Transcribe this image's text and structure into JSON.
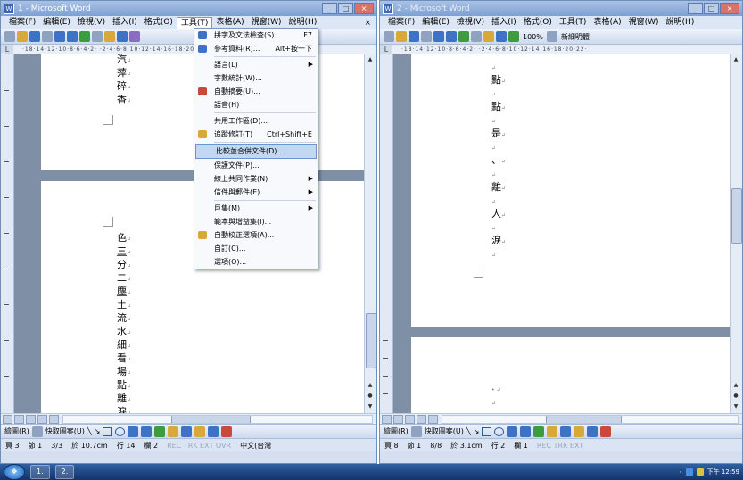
{
  "window1": {
    "title": "1 - Microsoft Word",
    "menu": [
      "檔案(F)",
      "編輯(E)",
      "檢視(V)",
      "插入(I)",
      "格式(O)",
      "工具(T)",
      "表格(A)",
      "視窗(W)",
      "說明(H)"
    ],
    "active_menu_index": 5,
    "close_doc": "×",
    "ruler_text": "·18·14·12·10·8·6·4·2· ·2·4·6·8·10·12·14·16·18·20·22·",
    "page_top_text": [
      "汽",
      "萍",
      "碎",
      "香"
    ],
    "page_bottom_text": [
      "色",
      "三",
      "分",
      "二",
      "塵",
      "土",
      "流",
      "水",
      "細",
      "看",
      "場",
      "點",
      "離",
      "淚"
    ],
    "underlined_chars": [
      "三",
      "塵"
    ],
    "status": {
      "page": "頁 3",
      "section": "節 1",
      "count": "3/3",
      "position": "於 10.7cm",
      "line": "行 14",
      "column": "欄 2",
      "modes": "REC TRK EXT OVR",
      "language": "中文(台灣"
    },
    "draw_label": "繪圖(R)",
    "autoshape_label": "快取圖案(U)"
  },
  "tools_menu": {
    "items": [
      {
        "label": "拼字及文法檢查(S)...",
        "shortcut": "F7",
        "icon": "spellcheck-icon",
        "color": "#3d72c4",
        "arrow": false
      },
      {
        "label": "參考資料(R)...",
        "shortcut": "Alt+按一下",
        "icon": "research-icon",
        "color": "#3d72c4",
        "arrow": false
      },
      {
        "label": "語言(L)",
        "shortcut": "",
        "icon": "",
        "color": "",
        "arrow": true
      },
      {
        "label": "字數統計(W)...",
        "shortcut": "",
        "icon": "",
        "color": "",
        "arrow": false
      },
      {
        "label": "自動摘要(U)...",
        "shortcut": "",
        "icon": "autosummary-icon",
        "color": "#c94a3a",
        "arrow": false
      },
      {
        "label": "語音(H)",
        "shortcut": "",
        "icon": "",
        "color": "",
        "arrow": false
      },
      {
        "label": "共用工作區(D)...",
        "shortcut": "",
        "icon": "",
        "color": "",
        "arrow": false
      },
      {
        "label": "追蹤修訂(T)",
        "shortcut": "Ctrl+Shift+E",
        "icon": "track-changes-icon",
        "color": "#d9a83a",
        "arrow": false
      },
      {
        "label": "比較並合併文件(D)...",
        "shortcut": "",
        "icon": "",
        "color": "",
        "arrow": false,
        "highlight": true
      },
      {
        "label": "保護文件(P)...",
        "shortcut": "",
        "icon": "",
        "color": "",
        "arrow": false
      },
      {
        "label": "線上共同作業(N)",
        "shortcut": "",
        "icon": "",
        "color": "",
        "arrow": true
      },
      {
        "label": "信件與郵件(E)",
        "shortcut": "",
        "icon": "",
        "color": "",
        "arrow": true
      },
      {
        "label": "巨集(M)",
        "shortcut": "",
        "icon": "",
        "color": "",
        "arrow": true
      },
      {
        "label": "範本與增益集(I)...",
        "shortcut": "",
        "icon": "",
        "color": "",
        "arrow": false
      },
      {
        "label": "自動校正選項(A)...",
        "shortcut": "",
        "icon": "autocorrect-icon",
        "color": "#d9a83a",
        "arrow": false
      },
      {
        "label": "自訂(C)...",
        "shortcut": "",
        "icon": "",
        "color": "",
        "arrow": false
      },
      {
        "label": "選項(O)...",
        "shortcut": "",
        "icon": "",
        "color": "",
        "arrow": false
      }
    ]
  },
  "window2": {
    "title": "2 - Microsoft Word",
    "menu": [
      "檔案(F)",
      "編輯(E)",
      "檢視(V)",
      "插入(I)",
      "格式(O)",
      "工具(T)",
      "表格(A)",
      "視窗(W)",
      "說明(H)"
    ],
    "zoom": "100%",
    "font": "新細明體",
    "ruler_text": "·18·14·12·10·8·6·4·2· ·2·4·6·8·10·12·14·16·18·20·22·",
    "page_top_text": [
      "",
      "點",
      "",
      "點",
      "",
      "是",
      "",
      "、",
      "",
      "離",
      "",
      "人",
      "",
      "淚",
      ""
    ],
    "status": {
      "page": "頁 8",
      "section": "節 1",
      "count": "8/8",
      "position": "於 3.1cm",
      "line": "行 2",
      "column": "欄 1",
      "modes": "REC TRK EXT"
    },
    "draw_label": "繪圖(R)",
    "autoshape_label": "快取圖案(U)"
  },
  "taskbar": {
    "tasks": [
      "1.",
      "2."
    ],
    "clock": "下午 12:59"
  },
  "colors": {
    "titlebar": "#7fa0d0",
    "menu_highlight": "#c3d6f2",
    "taskbar": "#12336b"
  }
}
